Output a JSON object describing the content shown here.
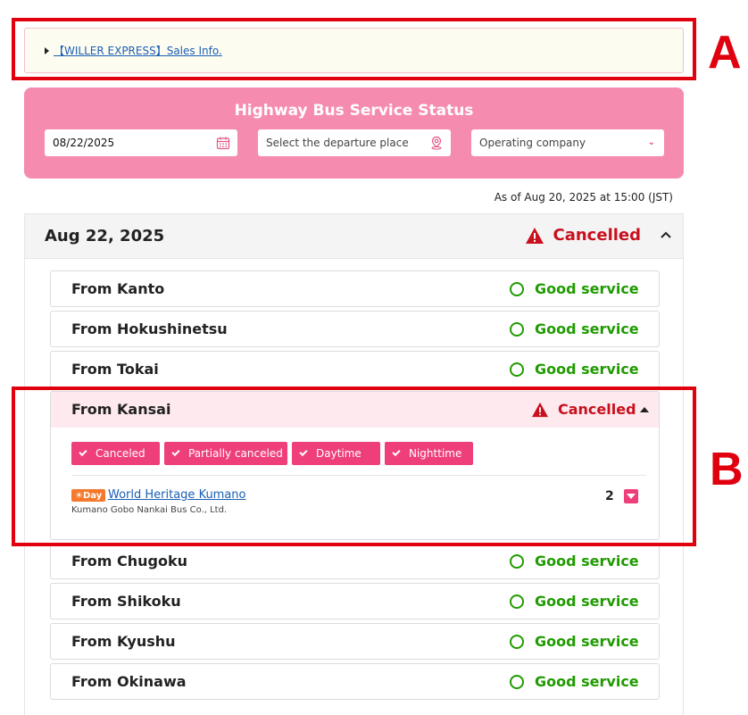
{
  "annotations": {
    "a": "A",
    "b": "B"
  },
  "sales_info": {
    "link": "【WILLER EXPRESS】Sales Info."
  },
  "search": {
    "title": "Highway Bus Service Status",
    "date_value": "08/22/2025",
    "departure_placeholder": "Select the departure place",
    "company_placeholder": "Operating company"
  },
  "as_of": "As of Aug 20, 2025 at 15:00 (JST)",
  "section": {
    "date": "Aug 22, 2025",
    "status": "Cancelled",
    "regions": [
      {
        "name": "From Kanto",
        "status": "Good service"
      },
      {
        "name": "From Hokushinetsu",
        "status": "Good service"
      },
      {
        "name": "From Tokai",
        "status": "Good service"
      },
      {
        "name": "From Kansai",
        "status": "Cancelled"
      },
      {
        "name": "From Chugoku",
        "status": "Good service"
      },
      {
        "name": "From Shikoku",
        "status": "Good service"
      },
      {
        "name": "From Kyushu",
        "status": "Good service"
      },
      {
        "name": "From Okinawa",
        "status": "Good service"
      }
    ],
    "kansai": {
      "filters": [
        "Canceled",
        "Partially canceled",
        "Daytime",
        "Nighttime"
      ],
      "route": {
        "badge": "☀Day",
        "name": "World Heritage Kumano",
        "company": "Kumano Gobo Nankai Bus Co., Ltd.",
        "count": "2"
      }
    }
  },
  "colors": {
    "good": "#1f9b00",
    "cancelled": "#c8101e",
    "accent": "#ef3f7a",
    "panel": "#f68bb0"
  },
  "icons": {
    "calendar": "calendar-icon",
    "location": "location-pin-icon",
    "warning": "warning-triangle-icon",
    "good": "circle-icon"
  }
}
